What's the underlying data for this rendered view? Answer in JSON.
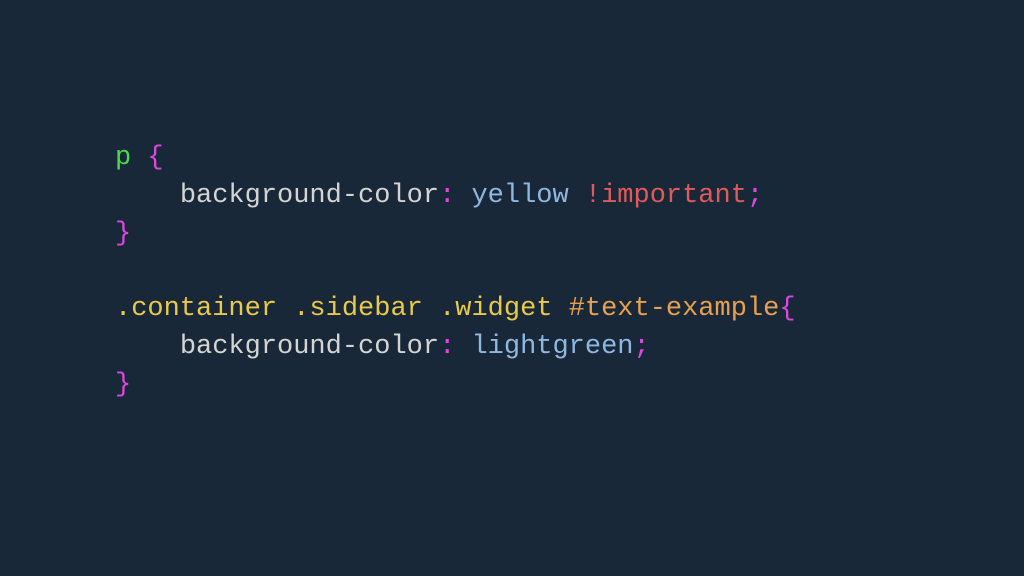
{
  "code": {
    "rule1": {
      "selector_tag": "p",
      "space": " ",
      "brace_open": "{",
      "indent": "    ",
      "property": "background-color",
      "colon": ":",
      "value_space": " ",
      "value": "yellow",
      "important_space": " ",
      "important": "!important",
      "semicolon": ";",
      "brace_close": "}"
    },
    "rule2": {
      "class1": ".container",
      "space1": " ",
      "class2": ".sidebar",
      "space2": " ",
      "class3": ".widget",
      "space3": " ",
      "id": "#text-example",
      "brace_open": "{",
      "indent": "    ",
      "property": "background-color",
      "colon": ":",
      "value_space": " ",
      "value": "lightgreen",
      "semicolon": ";",
      "brace_close": "}"
    }
  }
}
